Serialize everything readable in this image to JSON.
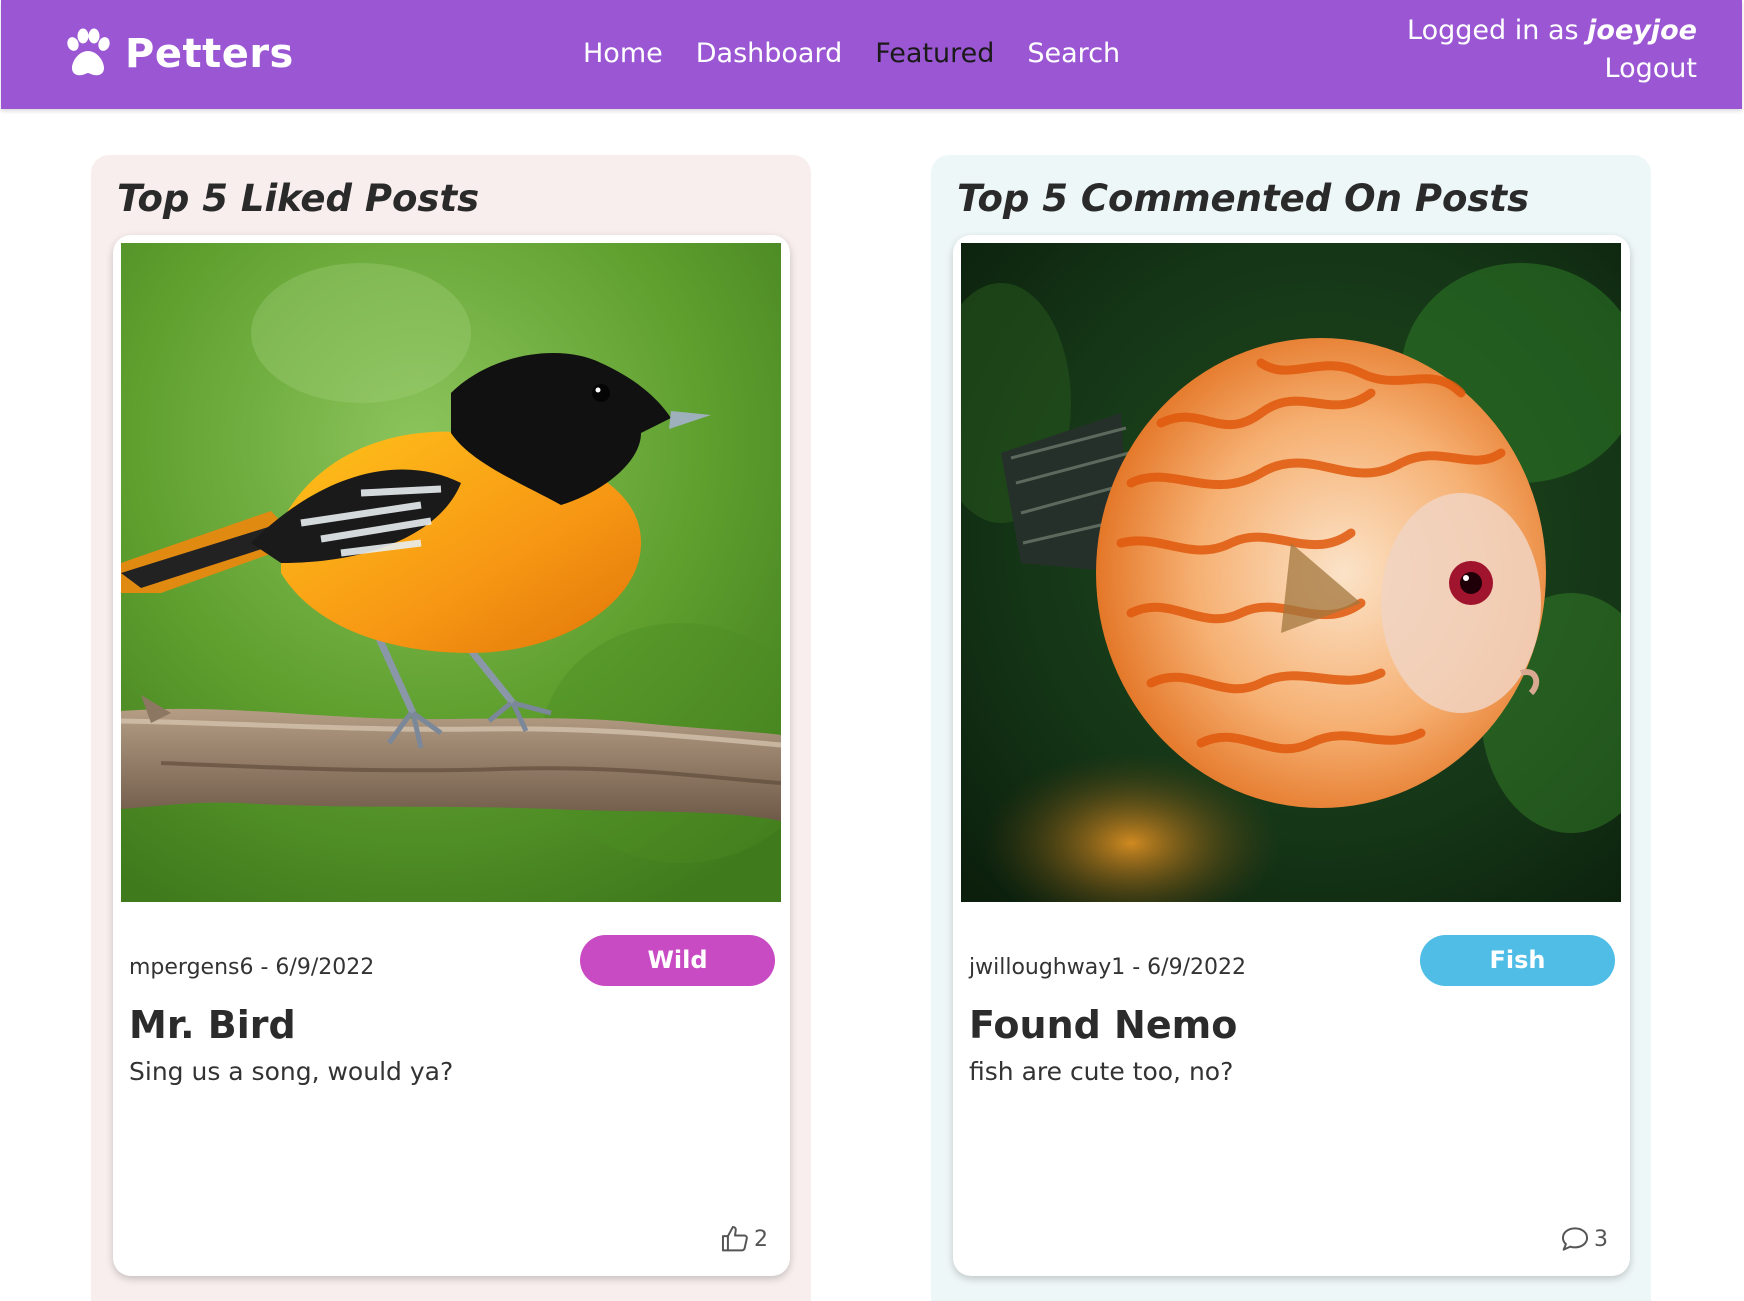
{
  "header": {
    "brand": "Petters",
    "brand_icon": "paw-icon",
    "nav": [
      "Home",
      "Dashboard",
      "Featured",
      "Search"
    ],
    "active_nav": "Featured",
    "logged_in_prefix": "Logged in as",
    "username": "joeyjoe",
    "logout_label": "Logout"
  },
  "sections": [
    {
      "title": "Top 5 Liked Posts",
      "post": {
        "author": "mpergens6",
        "date": "6/9/2022",
        "meta": "mpergens6 - 6/9/2022",
        "category": "Wild",
        "title": "Mr. Bird",
        "description": "Sing us a song, would ya?",
        "stat_icon": "thumbs-up-icon",
        "stat_count": "2"
      }
    },
    {
      "title": "Top 5 Commented On Posts",
      "post": {
        "author": "jwilloughway1",
        "date": "6/9/2022",
        "meta": "jwilloughway1 - 6/9/2022",
        "category": "Fish",
        "title": "Found Nemo",
        "description": "fish are cute too, no?",
        "stat_icon": "comment-icon",
        "stat_count": "3"
      }
    }
  ],
  "colors": {
    "navbar": "#9b57d3",
    "active_nav": "#1a1a1a",
    "badge_wild": "#c94bc3",
    "badge_fish": "#4fbde5",
    "panel_liked": "#f8eeee",
    "panel_commented": "#eef7f8"
  }
}
